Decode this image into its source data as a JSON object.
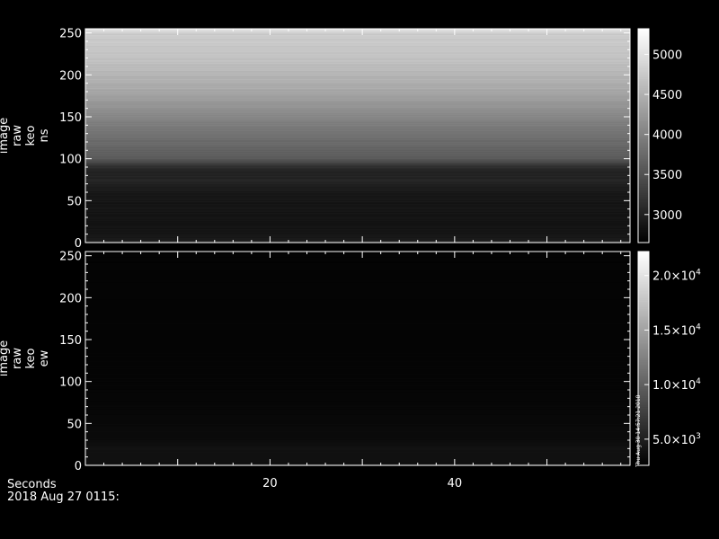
{
  "chart_data": [
    {
      "type": "heatmap",
      "title": "",
      "ylabel": "image raw keo ns",
      "ylabel_lines": [
        "image",
        "raw",
        "keo",
        "ns"
      ],
      "xlabel": "",
      "xlim": [
        0,
        59
      ],
      "ylim": [
        0,
        255
      ],
      "yticks": [
        0,
        50,
        100,
        150,
        200,
        250
      ],
      "colorbar": {
        "range": [
          2650,
          5320
        ],
        "ticks": [
          3000,
          3500,
          4000,
          4500,
          5000
        ],
        "tick_labels": [
          "3000",
          "3500",
          "4000",
          "4500",
          "5000"
        ]
      },
      "profile": [
        {
          "y": 0,
          "v": 3050
        },
        {
          "y": 5,
          "v": 2900
        },
        {
          "y": 20,
          "v": 2850
        },
        {
          "y": 60,
          "v": 2900
        },
        {
          "y": 75,
          "v": 3050
        },
        {
          "y": 85,
          "v": 3000
        },
        {
          "y": 92,
          "v": 3200
        },
        {
          "y": 100,
          "v": 3600
        },
        {
          "y": 140,
          "v": 3950
        },
        {
          "y": 180,
          "v": 4400
        },
        {
          "y": 220,
          "v": 4700
        },
        {
          "y": 250,
          "v": 4800
        },
        {
          "y": 255,
          "v": 5100
        }
      ]
    },
    {
      "type": "heatmap",
      "title": "",
      "ylabel": "image raw keo ew",
      "ylabel_lines": [
        "image",
        "raw",
        "keo",
        "ew"
      ],
      "xlabel": "Seconds",
      "xlim": [
        0,
        59
      ],
      "ylim": [
        0,
        255
      ],
      "yticks": [
        0,
        50,
        100,
        150,
        200,
        250
      ],
      "xticks": [
        20,
        40
      ],
      "colorbar": {
        "range": [
          2600,
          22200
        ],
        "ticks": [
          5000,
          10000,
          15000,
          20000
        ],
        "tick_labels": [
          {
            "mant": "5.0",
            "exp": "3"
          },
          {
            "mant": "1.0",
            "exp": "4"
          },
          {
            "mant": "1.5",
            "exp": "4"
          },
          {
            "mant": "2.0",
            "exp": "4"
          }
        ]
      },
      "profile": [
        {
          "y": 0,
          "v": 5200
        },
        {
          "y": 3,
          "v": 3800
        },
        {
          "y": 20,
          "v": 4000
        },
        {
          "y": 30,
          "v": 3500
        },
        {
          "y": 60,
          "v": 3200
        },
        {
          "y": 100,
          "v": 3000
        },
        {
          "y": 255,
          "v": 2900
        }
      ]
    }
  ],
  "footer": {
    "xaxis_label": "Seconds",
    "date": "2018 Aug 27 0115:",
    "side_stamp": "Thu Aug 30 14:57:21 2018"
  }
}
